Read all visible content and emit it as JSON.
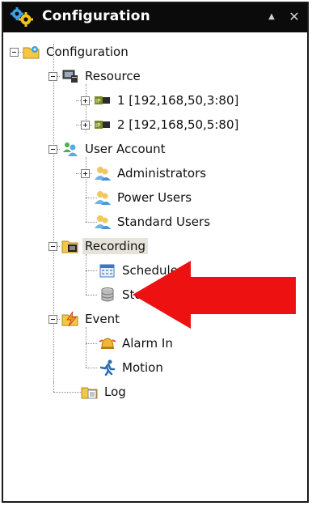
{
  "panel": {
    "title": "Configuration",
    "minimize_glyph": "▲",
    "close_glyph": "✕"
  },
  "tree": {
    "root": "Configuration",
    "resource": {
      "label": "Resource",
      "children": [
        "1 [192,168,50,3:80]",
        "2 [192,168,50,5:80]"
      ]
    },
    "user_account": {
      "label": "User Account",
      "children": [
        "Administrators",
        "Power Users",
        "Standard Users"
      ]
    },
    "recording": {
      "label": "Recording",
      "children": [
        "Schedule",
        "Storage"
      ]
    },
    "event": {
      "label": "Event",
      "children": [
        "Alarm In",
        "Motion"
      ]
    },
    "log": "Log"
  },
  "annotation": {
    "arrow_color": "#ee1111"
  }
}
